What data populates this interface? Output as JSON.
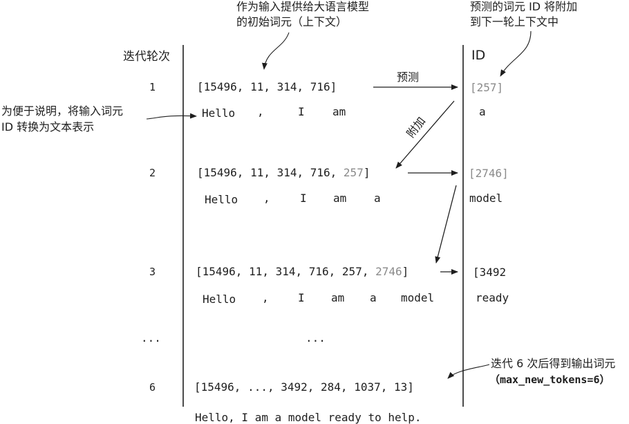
{
  "annotations": {
    "top_input_line1": "作为输入提供给大语言模型",
    "top_input_line2": "的初始词元（上下文）",
    "top_right_line1": "预测的词元 ID 将附加",
    "top_right_line2": "到下一轮上下文中",
    "left_line1": "为便于说明，将输入词元",
    "left_line2": "ID 转换为文本表示",
    "bottom_right_line1": "迭代 6 次后得到输出词元",
    "bottom_right_line2": "（max_new_tokens=6）",
    "predict_label": "预测",
    "append_label": "附加"
  },
  "headers": {
    "iteration": "迭代轮次",
    "id": "ID"
  },
  "rows": [
    {
      "iter": "1",
      "ids_main": "[15496, 11, 314, 716]",
      "ids_gray": "",
      "ids_close": "",
      "tokens": [
        "Hello",
        ",",
        "I",
        "am"
      ],
      "pred_id": "[257]",
      "pred_word": "a"
    },
    {
      "iter": "2",
      "ids_main": "[15496, 11, 314, 716, ",
      "ids_gray": "257",
      "ids_close": "]",
      "tokens": [
        "Hello",
        ",",
        "I",
        "am",
        "a"
      ],
      "pred_id": "[2746]",
      "pred_word": "model"
    },
    {
      "iter": "3",
      "ids_main": "[15496, 11, 314, 716, 257, ",
      "ids_gray": "2746",
      "ids_close": "]",
      "tokens": [
        "Hello",
        ",",
        "I",
        "am",
        "a",
        "model"
      ],
      "pred_id": "[3492",
      "pred_word": "ready"
    },
    {
      "iter": "6",
      "ids_main": "[15496, ..., 3492, 284, 1037, 13]",
      "ids_gray": "",
      "ids_close": "",
      "tokens": [],
      "pred_id": "",
      "pred_word": ""
    }
  ],
  "ellipsis": {
    "iter": "...",
    "middle": "..."
  },
  "final_output": "Hello, I am a model ready to help."
}
